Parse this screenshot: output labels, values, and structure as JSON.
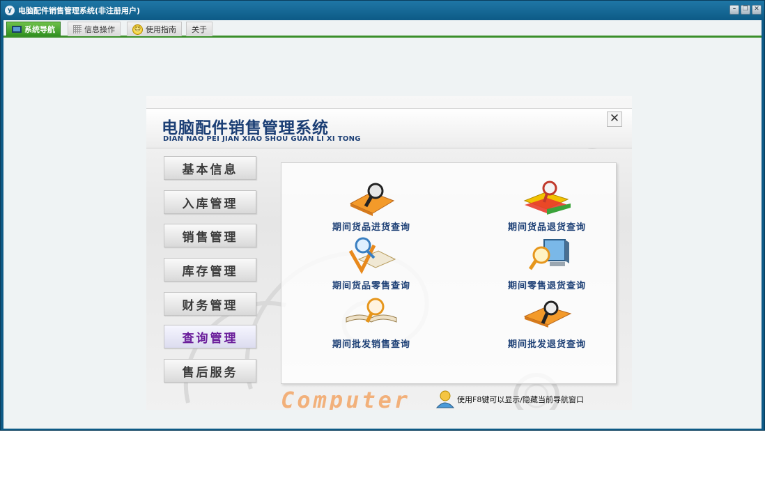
{
  "window": {
    "title": "电脑配件销售管理系统(非注册用户)",
    "app_icon_text": "y"
  },
  "tabs": [
    {
      "label": "系统导航",
      "icon": "monitor-icon",
      "active": true
    },
    {
      "label": "信息操作",
      "icon": "grid-icon",
      "active": false
    },
    {
      "label": "使用指南",
      "icon": "smiley-icon",
      "active": false
    },
    {
      "label": "关于",
      "icon": "",
      "active": false
    }
  ],
  "nav": {
    "title": "电脑配件销售管理系统",
    "subtitle": "DIAN NAO PEI JIAN XIAO SHOU GUAN LI XI TONG",
    "close_glyph": "✕",
    "menu": [
      {
        "label": "基本信息",
        "active": false
      },
      {
        "label": "入库管理",
        "active": false
      },
      {
        "label": "销售管理",
        "active": false
      },
      {
        "label": "库存管理",
        "active": false
      },
      {
        "label": "财务管理",
        "active": false
      },
      {
        "label": "查询管理",
        "active": true
      },
      {
        "label": "售后服务",
        "active": false
      }
    ],
    "queries": [
      {
        "label": "期间货品进货查询",
        "icon": "book-magnifier-icon"
      },
      {
        "label": "期间货品退货查询",
        "icon": "books-magnifier-icon"
      },
      {
        "label": "期间货品零售查询",
        "icon": "check-book-magnifier-icon"
      },
      {
        "label": "期间零售退货查询",
        "icon": "monitor-magnifier-icon"
      },
      {
        "label": "期间批发销售查询",
        "icon": "open-book-magnifier-icon"
      },
      {
        "label": "期间批发退货查询",
        "icon": "folder-magnifier-icon"
      }
    ],
    "decor_word": "Computer",
    "hint": "使用F8键可以显示/隐藏当前导航窗口"
  },
  "colors": {
    "title_blue": "#1c3f75",
    "tab_green": "#2e8f1f",
    "active_menu_text": "#6a1d9a",
    "window_frame": "#0e5a86"
  }
}
